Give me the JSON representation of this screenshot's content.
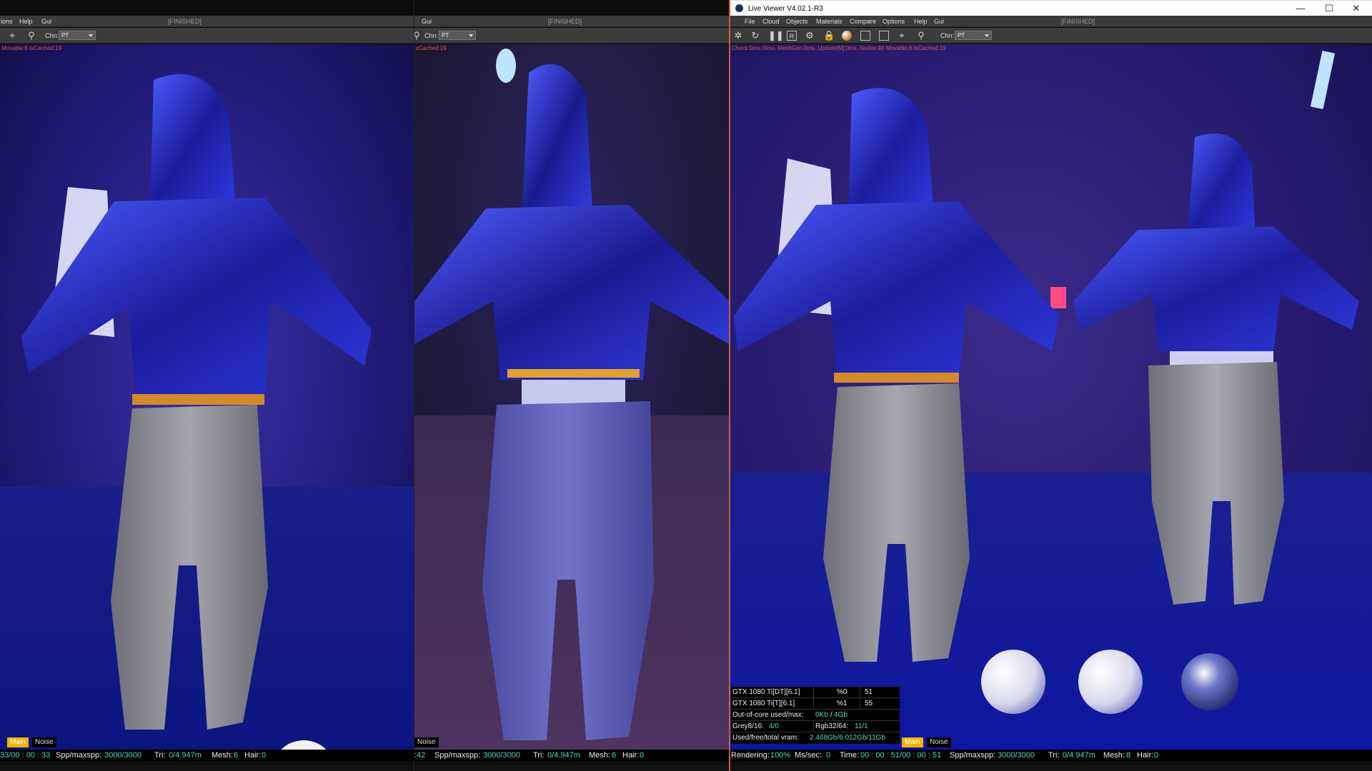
{
  "panel_left": {
    "menu": [
      "ions",
      "Help",
      "Gui"
    ],
    "status_label": "[FINISHED]",
    "channel_label": "Chn:",
    "channel_value": "PT",
    "stats_text": "Movable:6 txCached:19",
    "tabs": {
      "main": "Main",
      "noise": "Noise"
    },
    "footer": {
      "time": "33/00 : 00 : 33",
      "spp_label": "Spp/maxspp:",
      "spp_value": "3000/3000",
      "tri_label": "Tri:",
      "tri_value": "0/4.947m",
      "mesh_label": "Mesh:",
      "mesh_value": "6",
      "hair_label": "Hair:",
      "hair_value": "0"
    }
  },
  "panel_middle": {
    "menu": [
      "Gui"
    ],
    "status_label": "[FINISHED]",
    "channel_label": "Chn:",
    "channel_value": "PT",
    "stats_text": "xCached:19",
    "tabs": {
      "noise": "Noise"
    },
    "footer": {
      "time": ":42",
      "spp_label": "Spp/maxspp:",
      "spp_value": "3000/3000",
      "tri_label": "Tri:",
      "tri_value": "0/4.947m",
      "mesh_label": "Mesh:",
      "mesh_value": "6",
      "hair_label": "Hair:",
      "hair_value": "0"
    }
  },
  "panel_right": {
    "window_title": "Live Viewer V4.02.1-R3",
    "window_controls": {
      "minimize": "—",
      "maximize": "☐",
      "close": "✕"
    },
    "menu": [
      "File",
      "Cloud",
      "Objects",
      "Materials",
      "Compare",
      "Options",
      "Help",
      "Gui"
    ],
    "status_label": "[FINISHED]",
    "channel_label": "Chn:",
    "channel_value": "PT",
    "toolbar_icons": [
      "settings-icon",
      "refresh-icon",
      "pause-icon",
      "region-icon",
      "gear-icon",
      "lock-icon",
      "material-ball-icon",
      "focus-picker-icon",
      "white-balance-icon",
      "pick-icon",
      "pin-icon"
    ],
    "stats_text": "Check:0ms./0ms. MeshGen:0ms. Update[M]:0ms. Nodes:46 Movable:6 txCached:19",
    "gpus": [
      {
        "name": "GTX 1080 Ti[DT][6.1]",
        "usage": "%0",
        "temp": "51"
      },
      {
        "name": "GTX 1080 Ti[T][6.1]",
        "usage": "%1",
        "temp": "55"
      }
    ],
    "out_of_core": {
      "label": "Out-of-core used/max:",
      "used": "0Kb",
      "max": "4Gb"
    },
    "textures": {
      "grey_label": "Grey8/16:",
      "grey_value": "4/0",
      "rgb_label": "Rgb32/64:",
      "rgb_value": "11/1"
    },
    "vram": {
      "label": "Used/free/total vram:",
      "value": "2.468Gb/6.012Gb/11Gb"
    },
    "tabs": {
      "main": "Main",
      "noise": "Noise"
    },
    "footer": {
      "rendering_label": "Rendering:",
      "rendering_value": "100%",
      "ms_label": "Ms/sec:",
      "ms_value": "0",
      "time_label": "Time:",
      "time_value": "00 : 00 : 51/00 : 00 : 51",
      "spp_label": "Spp/maxspp:",
      "spp_value": "3000/3000",
      "tri_label": "Tri:",
      "tri_value": "0/4.947m",
      "mesh_label": "Mesh:",
      "mesh_value": "8",
      "hair_label": "Hair:",
      "hair_value": "0"
    }
  }
}
